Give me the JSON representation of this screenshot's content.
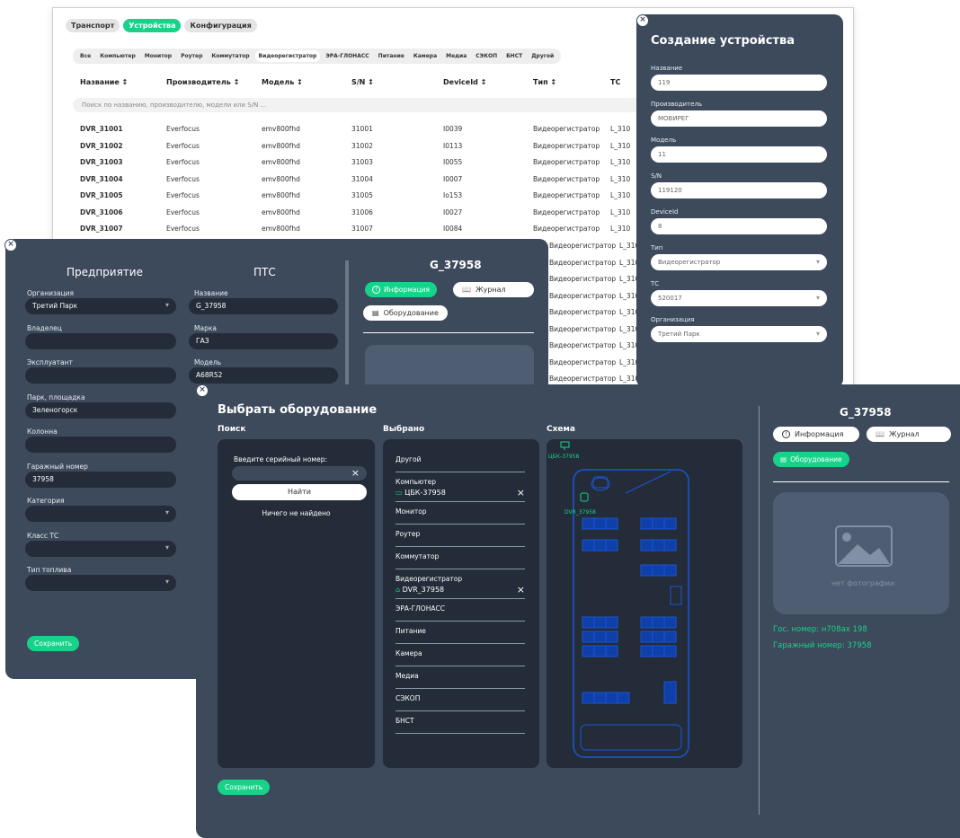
{
  "devices_window": {
    "top_tabs": [
      "Транспорт",
      "Устройства",
      "Конфигурация"
    ],
    "active_top_tab": 1,
    "sub_tabs": [
      "Все",
      "Компьютер",
      "Монитор",
      "Роутер",
      "Коммутатор",
      "Видеорегистратор",
      "ЭРА-ГЛОНАСС",
      "Питание",
      "Камера",
      "Медиа",
      "СЭКОП",
      "БНСТ",
      "Другой"
    ],
    "active_sub_tab": 5,
    "columns": [
      "Название ↕",
      "Производитель ↕",
      "Модель ↕",
      "S/N ↕",
      "DeviceId ↕",
      "Тип ↕",
      "ТС"
    ],
    "search_placeholder": "Поиск по названию, производителю, модели или S/N ...",
    "rows": [
      [
        "DVR_31001",
        "Everfocus",
        "emv800fhd",
        "31001",
        "I0039",
        "Видеорегистратор",
        "L_310"
      ],
      [
        "DVR_31002",
        "Everfocus",
        "emv800fhd",
        "31002",
        "I0113",
        "Видеорегистратор",
        "L_310"
      ],
      [
        "DVR_31003",
        "Everfocus",
        "emv800fhd",
        "31003",
        "I0055",
        "Видеорегистратор",
        "L_310"
      ],
      [
        "DVR_31004",
        "Everfocus",
        "emv800fhd",
        "31004",
        "I0007",
        "Видеорегистратор",
        "L_310"
      ],
      [
        "DVR_31005",
        "Everfocus",
        "emv800fhd",
        "31005",
        "Io153",
        "Видеорегистратор",
        "L_310"
      ],
      [
        "DVR_31006",
        "Everfocus",
        "emv800fhd",
        "31006",
        "I0027",
        "Видеорегистратор",
        "L_310"
      ],
      [
        "DVR_31007",
        "Everfocus",
        "emv800fhd",
        "31007",
        "I0084",
        "Видеорегистратор",
        "L_310"
      ]
    ],
    "hidden_rows_type": "Видеорегистратор",
    "hidden_rows_ts": "L_310"
  },
  "create_device": {
    "title": "Создание устройства",
    "fields": [
      {
        "label": "Название",
        "value": "119",
        "select": false
      },
      {
        "label": "Производитель",
        "value": "МОВИРЕГ",
        "select": false
      },
      {
        "label": "Модель",
        "value": "11",
        "select": false
      },
      {
        "label": "S/N",
        "value": "119120",
        "select": false
      },
      {
        "label": "DeviceId",
        "value": "8",
        "select": false
      },
      {
        "label": "Тип",
        "value": "Видеорегистратор",
        "select": true
      },
      {
        "label": "ТС",
        "value": "520017",
        "select": true
      },
      {
        "label": "Организация",
        "value": "Третий Парк",
        "select": true
      }
    ]
  },
  "enterprise": {
    "title": "Предприятие",
    "fields": [
      {
        "label": "Организация",
        "value": "Третий Парк",
        "select": true
      },
      {
        "label": "Владелец",
        "value": "",
        "select": false
      },
      {
        "label": "Эксплуатант",
        "value": "",
        "select": false
      },
      {
        "label": "Парк, площадка",
        "value": "Зеленогорск",
        "select": false
      },
      {
        "label": "Колонна",
        "value": "",
        "select": false
      },
      {
        "label": "Гаражный номер",
        "value": "37958",
        "select": false
      },
      {
        "label": "Категория",
        "value": "",
        "select": true
      },
      {
        "label": "Класс ТС",
        "value": "",
        "select": true
      },
      {
        "label": "Тип топлива",
        "value": "",
        "select": true
      }
    ],
    "save_label": "Сохранить"
  },
  "pts": {
    "title": "ПТС",
    "fields": [
      {
        "label": "Название",
        "value": "G_37958"
      },
      {
        "label": "Марка",
        "value": "ГАЗ"
      },
      {
        "label": "Модель",
        "value": "A68R52"
      }
    ]
  },
  "vehicle_card_back": {
    "title": "G_37958",
    "info_label": "Информация",
    "journal_label": "Журнал",
    "equipment_label": "Оборудование"
  },
  "select_equipment": {
    "title": "Выбрать оборудование",
    "search_header": "Поиск",
    "selected_header": "Выбрано",
    "scheme_header": "Схема",
    "serial_label": "Введите серийный номер:",
    "find_label": "Найти",
    "not_found": "Ничего не найдено",
    "categories": [
      {
        "name": "Другой",
        "item": ""
      },
      {
        "name": "Компьютер",
        "item": "ЦБК-37958"
      },
      {
        "name": "Монитор",
        "item": ""
      },
      {
        "name": "Роутер",
        "item": ""
      },
      {
        "name": "Коммутатор",
        "item": ""
      },
      {
        "name": "Видеорегистратор",
        "item": "DVR_37958"
      },
      {
        "name": "ЭРА-ГЛОНАСС",
        "item": ""
      },
      {
        "name": "Питание",
        "item": ""
      },
      {
        "name": "Камера",
        "item": ""
      },
      {
        "name": "Медиа",
        "item": ""
      },
      {
        "name": "СЭКОП",
        "item": ""
      },
      {
        "name": "БНСТ",
        "item": ""
      }
    ],
    "scheme_labels": {
      "computer": "ЦБК-37958",
      "dvr": "DVR_37958"
    },
    "save_label": "Сохранить"
  },
  "vehicle_card": {
    "title": "G_37958",
    "info_label": "Информация",
    "journal_label": "Журнал",
    "equipment_label": "Оборудование",
    "no_photo": "нет фотографии",
    "gos_number": "Гос. номер: н708ах 198",
    "garage_number": "Гаражный номер: 37958"
  },
  "colors": {
    "accent": "#17d38a",
    "panel": "#3d4a5c",
    "dark": "#232c38",
    "scheme_blue": "#1a56d6"
  }
}
